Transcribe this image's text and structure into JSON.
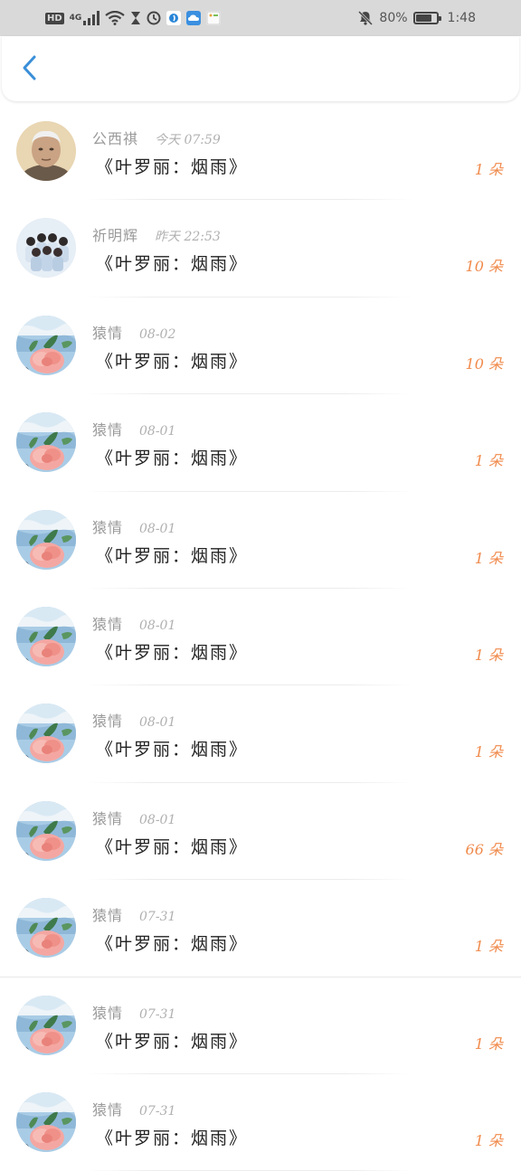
{
  "status_bar": {
    "hd": "HD",
    "net": "4G",
    "battery_pct": "80%",
    "battery_level": 0.8,
    "time": "1:48",
    "icons": [
      "signal-icon",
      "wifi-icon",
      "hourglass-icon",
      "clock-icon",
      "app-notification-icon",
      "cloud-icon",
      "photo-icon",
      "mute-bell-icon",
      "battery-icon"
    ]
  },
  "header": {
    "back_icon": "chevron-left-icon",
    "accent_color": "#3a8fd8"
  },
  "list": {
    "count_color": "#f08a4b",
    "rows": [
      {
        "name": "公西祺",
        "time": "今天 07:59",
        "title": "《叶罗丽：烟雨》",
        "count": "1 朵",
        "avatar": "elderly-man-avatar"
      },
      {
        "name": "祈明辉",
        "time": "昨天 22:53",
        "title": "《叶罗丽：烟雨》",
        "count": "10 朵",
        "avatar": "group-photo-avatar"
      },
      {
        "name": "猿情",
        "time": "08-02",
        "title": "《叶罗丽：烟雨》",
        "count": "10 朵",
        "avatar": "flower-avatar"
      },
      {
        "name": "猿情",
        "time": "08-01",
        "title": "《叶罗丽：烟雨》",
        "count": "1 朵",
        "avatar": "flower-avatar"
      },
      {
        "name": "猿情",
        "time": "08-01",
        "title": "《叶罗丽：烟雨》",
        "count": "1 朵",
        "avatar": "flower-avatar"
      },
      {
        "name": "猿情",
        "time": "08-01",
        "title": "《叶罗丽：烟雨》",
        "count": "1 朵",
        "avatar": "flower-avatar"
      },
      {
        "name": "猿情",
        "time": "08-01",
        "title": "《叶罗丽：烟雨》",
        "count": "1 朵",
        "avatar": "flower-avatar"
      },
      {
        "name": "猿情",
        "time": "08-01",
        "title": "《叶罗丽：烟雨》",
        "count": "66 朵",
        "avatar": "flower-avatar"
      },
      {
        "name": "猿情",
        "time": "07-31",
        "title": "《叶罗丽：烟雨》",
        "count": "1 朵",
        "avatar": "flower-avatar"
      },
      {
        "name": "猿情",
        "time": "07-31",
        "title": "《叶罗丽：烟雨》",
        "count": "1 朵",
        "avatar": "flower-avatar"
      },
      {
        "name": "猿情",
        "time": "07-31",
        "title": "《叶罗丽：烟雨》",
        "count": "1 朵",
        "avatar": "flower-avatar"
      }
    ]
  }
}
